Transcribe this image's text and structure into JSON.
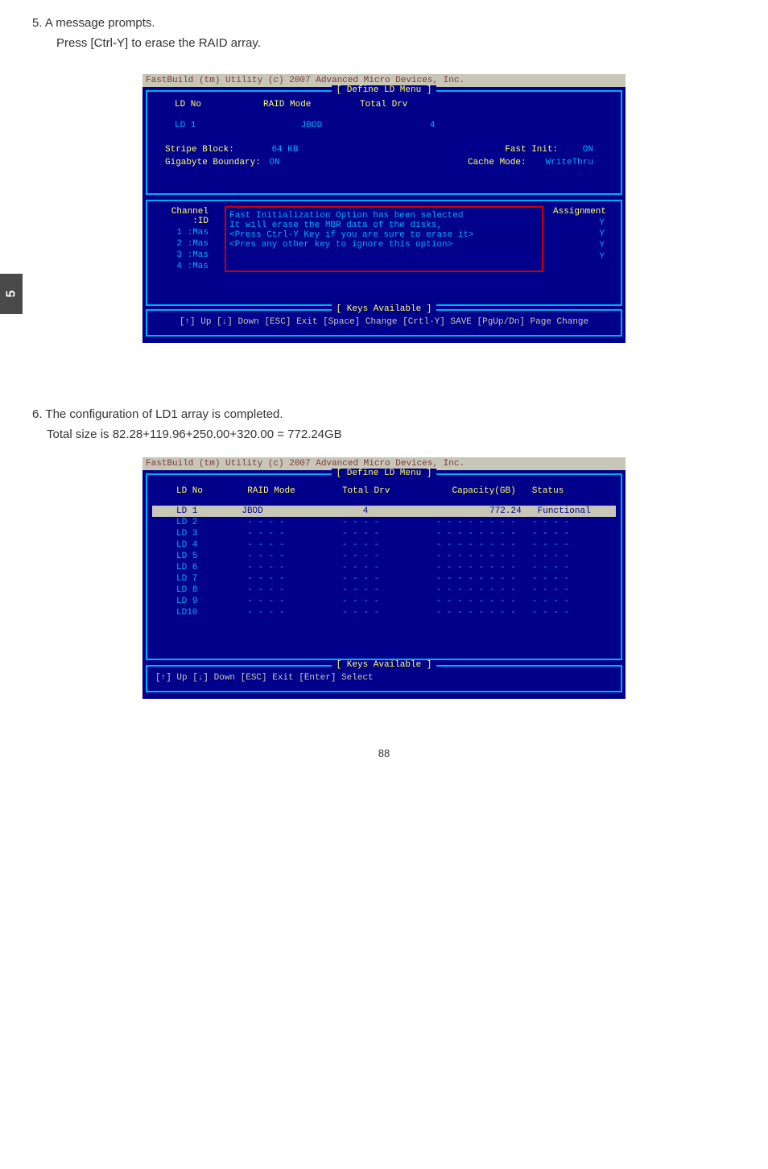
{
  "step5": {
    "heading": "5. A message prompts.",
    "sub": "Press [Ctrl-Y] to erase the RAID array."
  },
  "step6": {
    "heading": "6. The configuration of LD1 array is completed.",
    "sub": "Total size is 82.28+119.96+250.00+320.00 = 772.24GB"
  },
  "bios_title": "FastBuild (tm) Utility (c) 2007 Advanced Micro Devices, Inc.",
  "panel_label": "[ Define LD Menu ]",
  "keys_label": "[ Keys Available ]",
  "screen1": {
    "headers": {
      "ldno": "LD No",
      "raid_mode": "RAID Mode",
      "total_drv": "Total Drv"
    },
    "ld_row": {
      "ldno": "LD  1",
      "raid_mode": "JBOD",
      "total_drv": "4"
    },
    "stripe_label": "Stripe Block:",
    "stripe_val": "64  KB",
    "gb_label": "Gigabyte Boundary:",
    "gb_val": "ON",
    "fastinit_label": "Fast Init:",
    "fastinit_val": "ON",
    "cache_label": "Cache Mode:",
    "cache_val": "WriteThru",
    "channel_header": "Channel  :ID",
    "channel_rows": [
      "1 :Mas",
      "2 :Mas",
      "3 :Mas",
      "4 :Mas"
    ],
    "assignment_header": "Assignment",
    "assignment_vals": [
      "Y",
      "Y",
      "Y",
      "Y"
    ],
    "message": [
      "Fast Initialization Option has been selected",
      "It will erase the MBR data of the disks,",
      "<Press Ctrl-Y Key if you are sure to erase it>",
      "<Pres any other key to ignore this option>"
    ],
    "footer": "[↑] Up  [↓] Down  [ESC] Exit  [Space] Change  [Crtl-Y] SAVE   [PgUp/Dn] Page Change"
  },
  "screen2": {
    "headers": {
      "ldno": "LD No",
      "raid_mode": "RAID Mode",
      "total_drv": "Total Drv",
      "capacity": "Capacity(GB)",
      "status": "Status"
    },
    "highlighted": {
      "ldno": "LD  1",
      "raid_mode": "JBOD",
      "total_drv": "4",
      "capacity": "772.24",
      "status": "Functional"
    },
    "rows": [
      "LD  2",
      "LD  3",
      "LD  4",
      "LD  5",
      "LD  6",
      "LD  7",
      "LD  8",
      "LD  9",
      "LD10"
    ],
    "dash4": "- - - -",
    "dash8": "- - - - - - - -",
    "footer": "[↑] Up     [↓] Down     [ESC] Exit     [Enter] Select"
  },
  "side_chapter": "5",
  "page_number": "88"
}
